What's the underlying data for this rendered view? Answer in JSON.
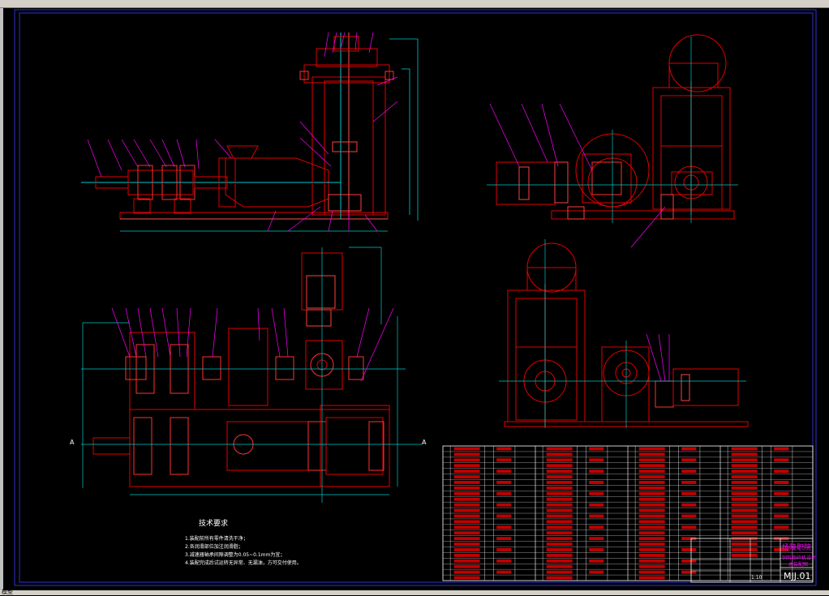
{
  "window": {
    "title_bar_text": "",
    "status_text": "模型"
  },
  "colors": {
    "background": "#000000",
    "frame": "#2020c8",
    "part": "#e00000",
    "leader": "#ff00ff",
    "dimension": "#00c8c8",
    "white": "#ffffff",
    "hatch": "#ff3333"
  },
  "notes": {
    "heading": "技术要求",
    "items": [
      "1.装配前所有零件清洗干净；",
      "2.各润滑部位加注润滑脂；",
      "3.减速器轴承间隙调整为0.05~0.1mm为宜；",
      "4.装配完成后试运转无异常、无漏油，方可交付使用。"
    ]
  },
  "title_block": {
    "school": "杨陵职院",
    "title": "饲料粉碎机设计",
    "sub": "总装配图",
    "drawing_no": "MJJ.01",
    "scale_label": "1:10"
  },
  "views": [
    {
      "name": "view-front-section",
      "label": ""
    },
    {
      "name": "view-side",
      "label": ""
    },
    {
      "name": "view-top",
      "label": ""
    },
    {
      "name": "view-end",
      "label": ""
    }
  ],
  "parts_table": {
    "rows": 24,
    "column_groups": 4
  }
}
